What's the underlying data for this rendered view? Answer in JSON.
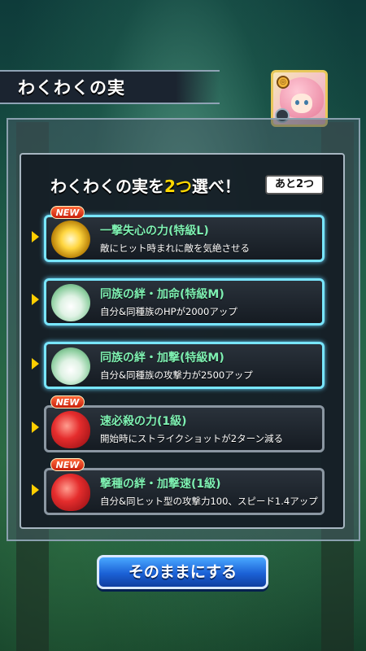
{
  "header": {
    "title": "わくわくの実"
  },
  "prompt": {
    "before": "わくわくの実を",
    "highlight": "2つ",
    "after": "選べ！"
  },
  "remaining": "あと2つ",
  "new_label": "NEW",
  "options": [
    {
      "name": "一撃失心の力(特級L)",
      "desc": "敵にヒット時まれに敵を気絶させる",
      "icon": "golden-burst-fruit-icon",
      "is_new": true
    },
    {
      "name": "同族の絆・加命(特級M)",
      "desc": "自分&同種族のHPが2000アップ",
      "icon": "white-lettuce-fruit-icon",
      "is_new": false
    },
    {
      "name": "同族の絆・加撃(特級M)",
      "desc": "自分&同種族の攻撃力が2500アップ",
      "icon": "white-lettuce-fruit-icon",
      "is_new": false
    },
    {
      "name": "速必殺の力(1級)",
      "desc": "開始時にストライクショットが2ターン減る",
      "icon": "red-fruit-icon",
      "is_new": true
    },
    {
      "name": "撃種の絆・加撃速(1級)",
      "desc": "自分&同ヒット型の攻撃力100、スピード1.4アップ",
      "icon": "red-fruit-icon",
      "is_new": true
    }
  ],
  "confirm_button": "そのままにする",
  "colors": {
    "accent_yellow": "#ffd800",
    "option_name": "#7ef0b2",
    "button_blue": "#1b61d6"
  }
}
